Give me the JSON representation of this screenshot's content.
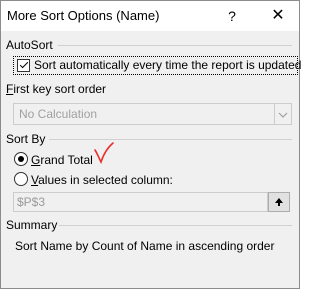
{
  "dialog": {
    "title": "More Sort Options (Name)",
    "help_label": "?",
    "close_label": "✕"
  },
  "autosort": {
    "heading": "AutoSort",
    "checkbox_checked": true,
    "checkbox_label": "Sort automatically every time the report is updated"
  },
  "first_key": {
    "heading": "First key sort order",
    "heading_accel": "F",
    "heading_rest": "irst key sort order",
    "selected_value": "No Calculation",
    "arrow_icon": "chevron-down-icon"
  },
  "sort_by": {
    "heading": "Sort By",
    "option_grand_total": "Grand Total",
    "grand_total_accel": "G",
    "grand_total_rest": "rand Total",
    "grand_total_selected": true,
    "option_values": "Values in selected column:",
    "values_accel": "V",
    "values_rest": "alues in selected column:",
    "values_selected": false,
    "reference_value": "$P$3",
    "reference_button_icon": "collapse-dialog-icon"
  },
  "summary": {
    "heading": "Summary",
    "text": "Sort Name by Count of Name in ascending order"
  },
  "colors": {
    "annotation": "#e8312a",
    "dialog_bg": "#f0f0f0"
  }
}
